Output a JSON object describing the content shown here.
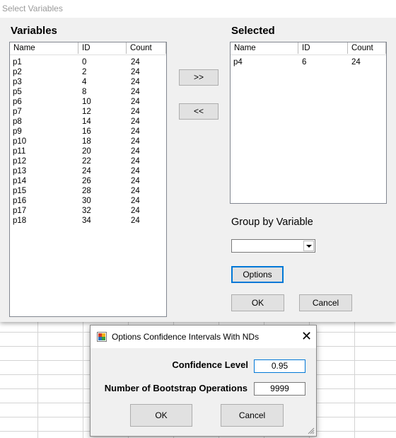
{
  "window": {
    "title": "Select Variables"
  },
  "variables": {
    "title": "Variables",
    "columns": [
      "Name",
      "ID",
      "Count"
    ],
    "rows": [
      [
        "p1",
        "0",
        "24"
      ],
      [
        "p2",
        "2",
        "24"
      ],
      [
        "p3",
        "4",
        "24"
      ],
      [
        "p5",
        "8",
        "24"
      ],
      [
        "p6",
        "10",
        "24"
      ],
      [
        "p7",
        "12",
        "24"
      ],
      [
        "p8",
        "14",
        "24"
      ],
      [
        "p9",
        "16",
        "24"
      ],
      [
        "p10",
        "18",
        "24"
      ],
      [
        "p11",
        "20",
        "24"
      ],
      [
        "p12",
        "22",
        "24"
      ],
      [
        "p13",
        "24",
        "24"
      ],
      [
        "p14",
        "26",
        "24"
      ],
      [
        "p15",
        "28",
        "24"
      ],
      [
        "p16",
        "30",
        "24"
      ],
      [
        "p17",
        "32",
        "24"
      ],
      [
        "p18",
        "34",
        "24"
      ]
    ]
  },
  "selected": {
    "title": "Selected",
    "columns": [
      "Name",
      "ID",
      "Count"
    ],
    "rows": [
      [
        "p4",
        "6",
        "24"
      ]
    ]
  },
  "buttons": {
    "add": ">>",
    "remove": "<<",
    "options": "Options",
    "ok": "OK",
    "cancel": "Cancel"
  },
  "group_by": {
    "label": "Group by Variable",
    "value": ""
  },
  "options_dialog": {
    "title": "Options Confidence Intervals With NDs",
    "close_glyph": "✕",
    "confidence_label": "Confidence Level",
    "confidence_value": "0.95",
    "bootstrap_label": "Number of Bootstrap Operations",
    "bootstrap_value": "9999",
    "ok": "OK",
    "cancel": "Cancel"
  }
}
